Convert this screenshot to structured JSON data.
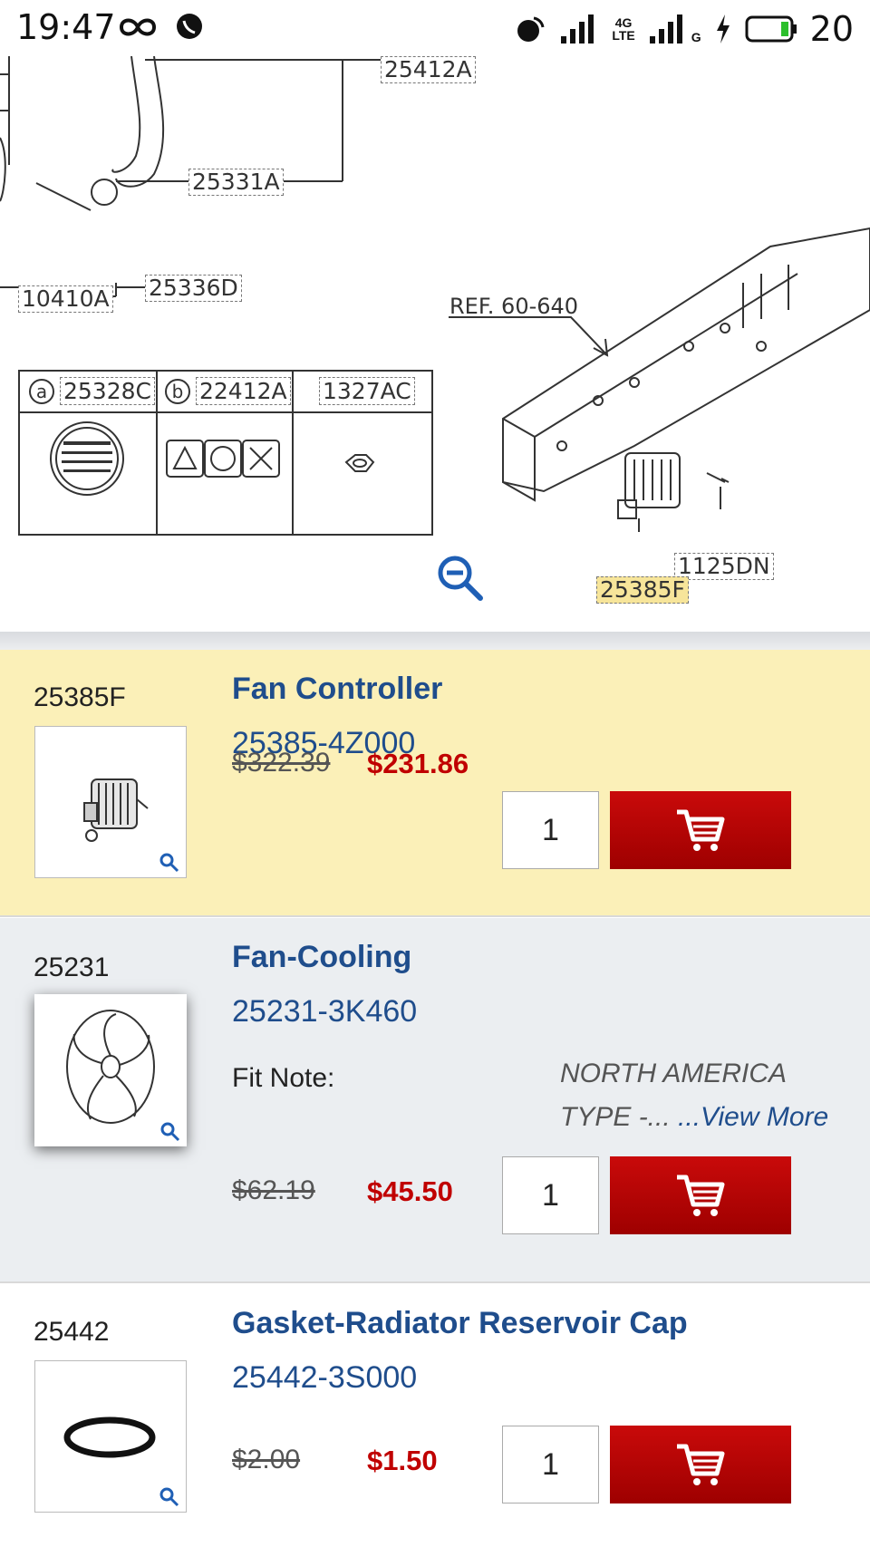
{
  "status_bar": {
    "time": "19:47",
    "battery": "20",
    "network": "4G",
    "network_sub": "LTE",
    "network2": "G"
  },
  "diagram": {
    "callouts": [
      "25412A",
      "25331A",
      "25336D",
      "10410A",
      "1125DN",
      "25385F"
    ],
    "ref_label": "REF. 60-640",
    "legend": {
      "a_letter": "a",
      "a_part": "25328C",
      "b_letter": "b",
      "b_part": "22412A",
      "c_part": "1327AC"
    }
  },
  "parts": [
    {
      "ref": "25385F",
      "name": "Fan Controller",
      "part_number": "25385-4Z000",
      "list_price": "$322.39",
      "sale_price": "$231.86",
      "qty": "1"
    },
    {
      "ref": "25231",
      "name": "Fan-Cooling",
      "part_number": "25231-3K460",
      "fit_note_label": "Fit Note:",
      "fit_note_line1": "NORTH AMERICA",
      "fit_note_line2": "TYPE -... ",
      "view_more": "...View More",
      "list_price": "$62.19",
      "sale_price": "$45.50",
      "qty": "1"
    },
    {
      "ref": "25442",
      "name": "Gasket-Radiator Reservoir Cap",
      "part_number": "25442-3S000",
      "list_price": "$2.00",
      "sale_price": "$1.50",
      "qty": "1"
    }
  ],
  "icons": {
    "cart": "cart-icon",
    "zoom_out": "zoom-out-icon",
    "magnify": "magnify-icon"
  },
  "colors": {
    "highlight_row": "#fbf0b8",
    "cart_button": "#b00000",
    "title_blue": "#1f4d8c",
    "sale_red": "#c00000"
  }
}
